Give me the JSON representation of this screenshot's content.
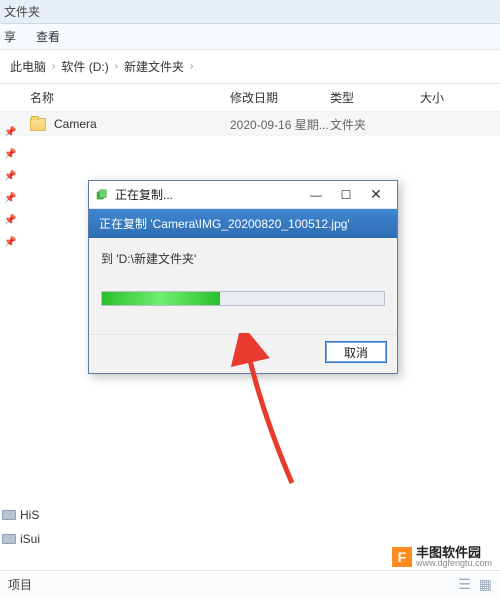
{
  "top_label": "文件夹",
  "menu": {
    "share": "享",
    "view": "查看"
  },
  "breadcrumbs": {
    "root": "此电脑",
    "drive": "软件 (D:)",
    "folder": "新建文件夹"
  },
  "columns": {
    "name": "名称",
    "date": "修改日期",
    "type": "类型",
    "size": "大小"
  },
  "files": [
    {
      "name": "Camera",
      "date": "2020-09-16 星期...",
      "type": "文件夹",
      "size": ""
    }
  ],
  "side_drives": [
    {
      "label": "HiS"
    },
    {
      "label": "iSui"
    }
  ],
  "status": {
    "items": "项目"
  },
  "dialog": {
    "title": "正在复制...",
    "blue_line": "正在复制 'Camera\\IMG_20200820_100512.jpg'",
    "dest": "到 'D:\\新建文件夹'",
    "cancel": "取消"
  },
  "watermark": {
    "cn": "丰图软件园",
    "url": "www.dgfengtu.com",
    "logo": "F"
  }
}
